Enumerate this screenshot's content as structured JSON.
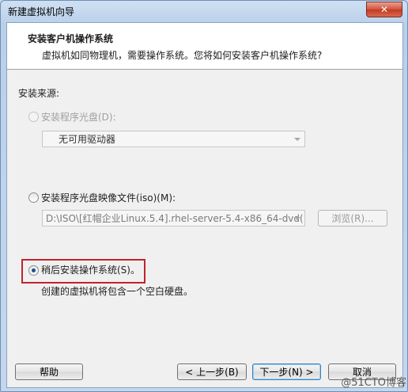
{
  "window": {
    "title": "新建虚拟机向导",
    "close_label": "✕"
  },
  "header": {
    "title": "安装客户机操作系统",
    "subtitle": "虚拟机如同物理机，需要操作系统。您将如何安装客户机操作系统?"
  },
  "install_source": {
    "label": "安装来源:",
    "options": [
      {
        "label": "安装程序光盘(D):",
        "selected": false,
        "enabled": false
      },
      {
        "label": "安装程序光盘映像文件(iso)(M):",
        "selected": false,
        "enabled": true
      },
      {
        "label": "稍后安装操作系统(S)。",
        "selected": true,
        "enabled": true
      }
    ],
    "disc_drive_value": "无可用驱动器",
    "iso_path_value": "D:\\ISO\\[红帽企业Linux.5.4].rhel-server-5.4-x86_64-dvd(",
    "browse_label": "浏览(R)...",
    "later_description": "创建的虚拟机将包含一个空白硬盘。"
  },
  "footer": {
    "help_label": "帮助",
    "back_label": "< 上一步(B)",
    "next_label": "下一步(N) >",
    "cancel_label": "取消"
  },
  "watermark": "@51CTO博客",
  "colors": {
    "highlight_box": "#c0242b",
    "title_bar": "#c4d7ee",
    "close_button": "#c23a22"
  }
}
